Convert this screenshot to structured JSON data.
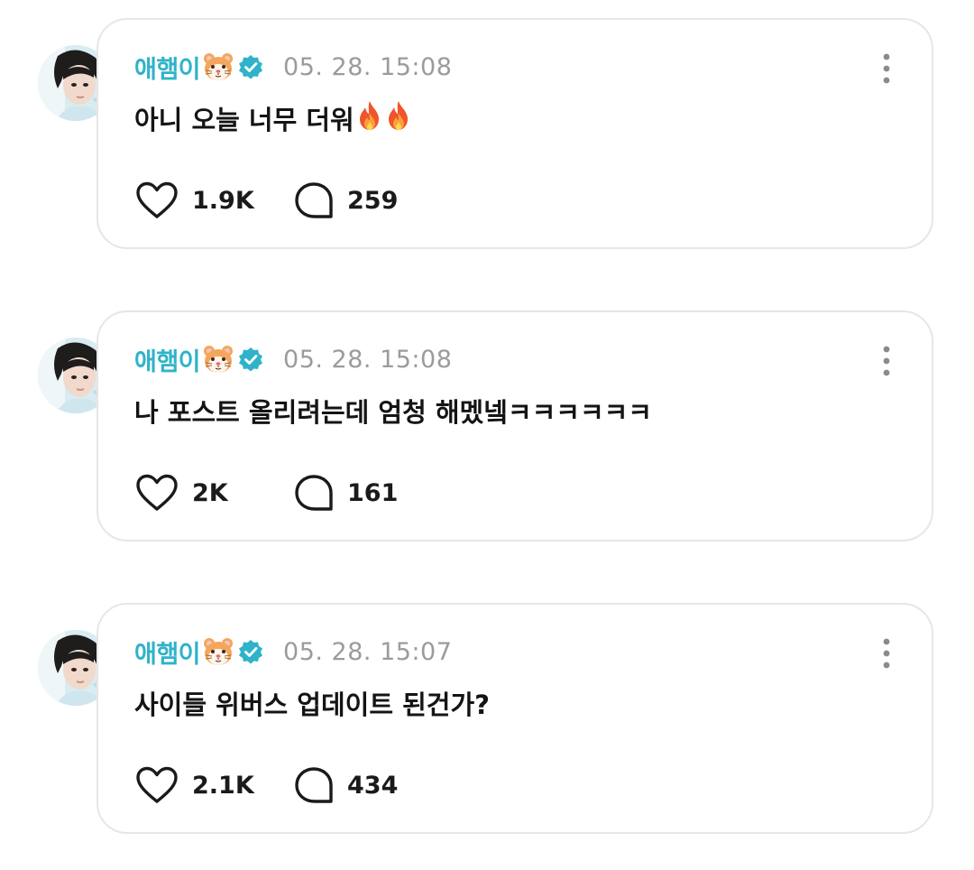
{
  "posts": [
    {
      "author": "애햄이",
      "date": "05. 28. 15:08",
      "text": "아니 오늘 너무 더워",
      "fire_count": 2,
      "likes": "1.9K",
      "comments": "259"
    },
    {
      "author": "애햄이",
      "date": "05. 28. 15:08",
      "text": "나 포스트 올리려는데 엄청 해멨넼ㅋㅋㅋㅋㅋㅋ",
      "fire_count": 0,
      "likes": "2K",
      "comments": "161"
    },
    {
      "author": "애햄이",
      "date": "05. 28. 15:07",
      "text": "사이들 위버스 업데이트 된건가?",
      "fire_count": 0,
      "likes": "2.1K",
      "comments": "434"
    }
  ],
  "icons": {
    "author_emoji": "hamster-face-icon",
    "verified": "verified-badge-icon",
    "more": "more-vertical-icon",
    "like": "heart-outline-icon",
    "comment": "comment-bubble-icon",
    "fire": "fire-icon"
  },
  "colors": {
    "author": "#2fb3c9",
    "verified": "#2fb3c9",
    "date": "#9b9b9b",
    "text": "#141414",
    "card_border": "#e6e6e6"
  }
}
